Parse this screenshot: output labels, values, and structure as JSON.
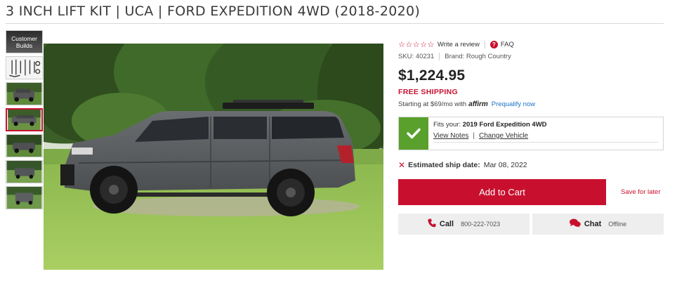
{
  "product": {
    "title": "3 INCH LIFT KIT | UCA | FORD EXPEDITION 4WD (2018-2020)"
  },
  "gallery": {
    "thumbs": [
      {
        "kind": "customer-builds",
        "label": "Customer Builds"
      },
      {
        "kind": "parts"
      },
      {
        "kind": "truck-front"
      },
      {
        "kind": "truck-side",
        "active": true
      },
      {
        "kind": "truck-front-2"
      },
      {
        "kind": "truck-rear"
      },
      {
        "kind": "truck-rear-2"
      }
    ]
  },
  "panel": {
    "stars": "☆☆☆☆☆",
    "write_review": "Write a review",
    "faq": "FAQ",
    "sku_label": "SKU:",
    "sku": "40231",
    "brand_label": "Brand:",
    "brand": "Rough Country",
    "price": "$1,224.95",
    "free_shipping": "FREE SHIPPING",
    "affirm_prefix": "Starting at $69/mo with",
    "affirm_logo": "affirm",
    "prequalify": "Prequalify now",
    "fits_prefix": "Fits your:",
    "fits_vehicle": "2019 Ford Expedition 4WD",
    "view_notes": "View Notes",
    "change_vehicle": "Change Vehicle",
    "ship_label": "Estimated ship date:",
    "ship_date": "Mar 08, 2022",
    "add_to_cart": "Add to Cart",
    "save_for_later": "Save for later",
    "call_label": "Call",
    "call_number": "800-222-7023",
    "chat_label": "Chat",
    "chat_status": "Offline"
  },
  "colors": {
    "accent": "#c8102e",
    "fits_green": "#5aa02c",
    "link_blue": "#1a73c8"
  }
}
